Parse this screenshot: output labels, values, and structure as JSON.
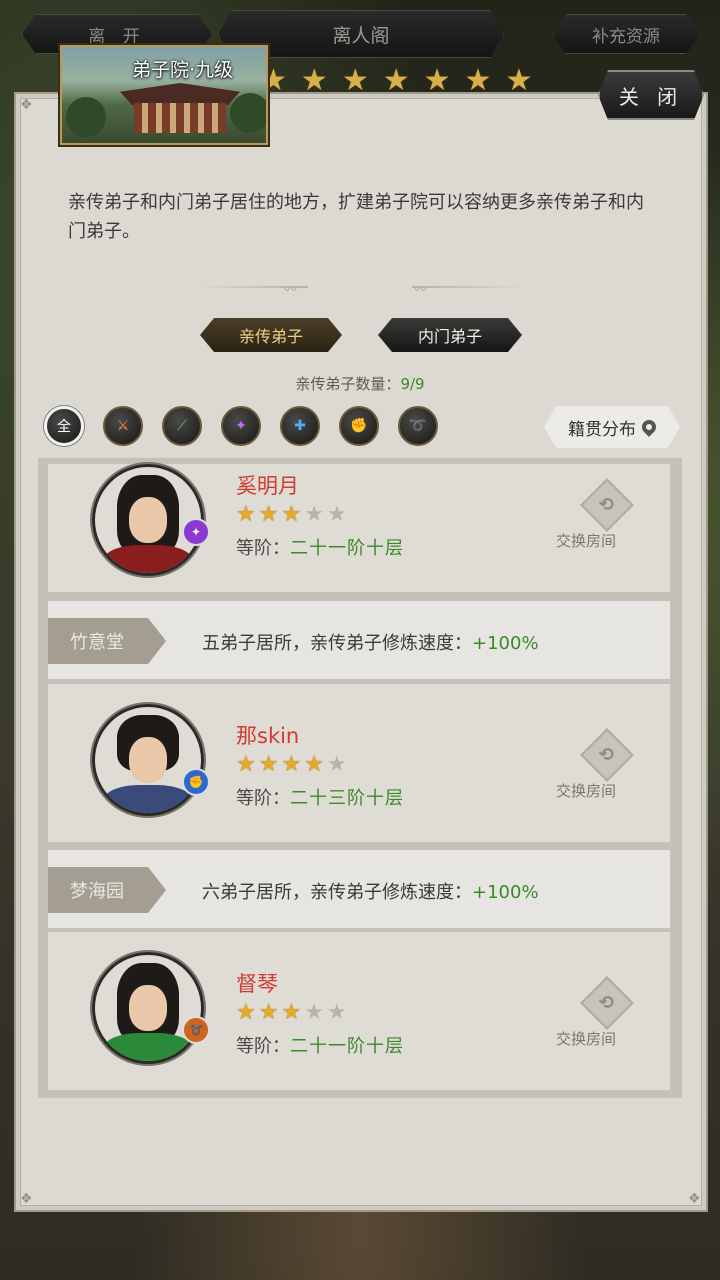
{
  "nav": {
    "leave": "离 开",
    "title": "离人阁",
    "supply": "补充资源"
  },
  "top_stars": [
    "★",
    "★",
    "★",
    "★",
    "★",
    "★",
    "★"
  ],
  "building": {
    "name": "弟子院·九级"
  },
  "close_label": "关 闭",
  "description": "亲传弟子和内门弟子居住的地方，扩建弟子院可以容纳更多亲传弟子和内门弟子。",
  "tabs": {
    "direct": "亲传弟子",
    "inner": "内门弟子"
  },
  "count": {
    "label": "亲传弟子数量：",
    "value": "9/9"
  },
  "filters": [
    {
      "label": "全",
      "icon": "all-icon"
    },
    {
      "label": "⚔",
      "icon": "sword-icon"
    },
    {
      "label": "⟋",
      "icon": "blade-icon"
    },
    {
      "label": "✦",
      "icon": "spear-icon"
    },
    {
      "label": "✚",
      "icon": "staff-icon"
    },
    {
      "label": "✊",
      "icon": "fist-icon"
    },
    {
      "label": "➰",
      "icon": "whip-icon"
    }
  ],
  "origin_label": "籍贯分布",
  "swap_label": "交换房间",
  "rank_label": "等阶：",
  "halls": [
    {
      "name": "竹意堂",
      "desc": "五弟子居所，亲传弟子修炼速度：",
      "bonus": "+100%"
    },
    {
      "name": "梦海园",
      "desc": "六弟子居所，亲传弟子修炼速度：",
      "bonus": "+100%"
    }
  ],
  "disciples": [
    {
      "name": "奚明月",
      "stars": 3,
      "max_stars": 5,
      "rank": "二十一阶十层",
      "weapon": "spear-icon",
      "weapon_color": "#8a3ad0"
    },
    {
      "name": "那skin",
      "stars": 4,
      "max_stars": 5,
      "rank": "二十三阶十层",
      "weapon": "fist-icon",
      "weapon_color": "#2a6ad0"
    },
    {
      "name": "督琴",
      "stars": 3,
      "max_stars": 5,
      "rank": "二十一阶十层",
      "weapon": "whip-icon",
      "weapon_color": "#d0641e"
    }
  ]
}
